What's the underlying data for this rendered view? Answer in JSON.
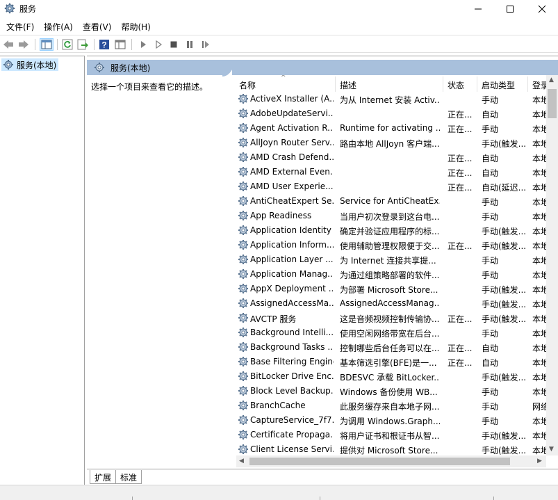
{
  "window": {
    "title": "服务"
  },
  "menu": [
    "文件(F)",
    "操作(A)",
    "查看(V)",
    "帮助(H)"
  ],
  "toolbar": {
    "icons": [
      "back-icon",
      "forward-icon",
      "show-hide-console-tree-icon",
      "refresh-icon",
      "export-list-icon",
      "help-icon",
      "properties-view-icon",
      "start-service-icon",
      "start-service-alt-icon",
      "stop-service-icon",
      "pause-service-icon",
      "restart-service-icon"
    ]
  },
  "tree": {
    "root_label": "服务(本地)"
  },
  "pane_header": {
    "title": "服务(本地)"
  },
  "description_prompt": "选择一个项目来查看它的描述。",
  "columns": {
    "name": "名称",
    "description": "描述",
    "status": "状态",
    "startup": "启动类型",
    "logon": "登录"
  },
  "services": [
    {
      "name": "ActiveX Installer (A...",
      "description": "为从 Internet 安装 Activ...",
      "status": "",
      "startup": "手动",
      "logon": "本地"
    },
    {
      "name": "AdobeUpdateServi...",
      "description": "",
      "status": "正在...",
      "startup": "自动",
      "logon": "本地"
    },
    {
      "name": "Agent Activation R...",
      "description": "Runtime for activating ...",
      "status": "正在...",
      "startup": "手动",
      "logon": "本地"
    },
    {
      "name": "AllJoyn Router Serv...",
      "description": "路由本地 AllJoyn 客户端...",
      "status": "",
      "startup": "手动(触发...",
      "logon": "本地"
    },
    {
      "name": "AMD Crash Defend...",
      "description": "",
      "status": "正在...",
      "startup": "自动",
      "logon": "本地"
    },
    {
      "name": "AMD External Even...",
      "description": "",
      "status": "正在...",
      "startup": "自动",
      "logon": "本地"
    },
    {
      "name": "AMD User Experie...",
      "description": "",
      "status": "正在...",
      "startup": "自动(延迟...",
      "logon": "本地"
    },
    {
      "name": "AntiCheatExpert Se...",
      "description": "Service for AntiCheatEx...",
      "status": "",
      "startup": "手动",
      "logon": "本地"
    },
    {
      "name": "App Readiness",
      "description": "当用户初次登录到这台电...",
      "status": "",
      "startup": "手动",
      "logon": "本地"
    },
    {
      "name": "Application Identity",
      "description": "确定并验证应用程序的标...",
      "status": "",
      "startup": "手动(触发...",
      "logon": "本地"
    },
    {
      "name": "Application Inform...",
      "description": "使用辅助管理权限便于交...",
      "status": "正在...",
      "startup": "手动(触发...",
      "logon": "本地"
    },
    {
      "name": "Application Layer ...",
      "description": "为 Internet 连接共享提...",
      "status": "",
      "startup": "手动",
      "logon": "本地"
    },
    {
      "name": "Application Manag...",
      "description": "为通过组策略部署的软件...",
      "status": "",
      "startup": "手动",
      "logon": "本地"
    },
    {
      "name": "AppX Deployment ...",
      "description": "为部署 Microsoft Store...",
      "status": "",
      "startup": "手动(触发...",
      "logon": "本地"
    },
    {
      "name": "AssignedAccessMa...",
      "description": "AssignedAccessManag...",
      "status": "",
      "startup": "手动(触发...",
      "logon": "本地"
    },
    {
      "name": "AVCTP 服务",
      "description": "这是音频视频控制传输协...",
      "status": "正在...",
      "startup": "手动(触发...",
      "logon": "本地"
    },
    {
      "name": "Background Intelli...",
      "description": "使用空闲网络带宽在后台...",
      "status": "",
      "startup": "手动",
      "logon": "本地"
    },
    {
      "name": "Background Tasks ...",
      "description": "控制哪些后台任务可以在...",
      "status": "正在...",
      "startup": "自动",
      "logon": "本地"
    },
    {
      "name": "Base Filtering Engine",
      "description": "基本筛选引擎(BFE)是一...",
      "status": "正在...",
      "startup": "自动",
      "logon": "本地"
    },
    {
      "name": "BitLocker Drive Enc...",
      "description": "BDESVC 承载 BitLocker...",
      "status": "",
      "startup": "手动(触发...",
      "logon": "本地"
    },
    {
      "name": "Block Level Backup...",
      "description": "Windows 备份使用 WB...",
      "status": "",
      "startup": "手动",
      "logon": "本地"
    },
    {
      "name": "BranchCache",
      "description": "此服务缓存来自本地子网...",
      "status": "",
      "startup": "手动",
      "logon": "网络"
    },
    {
      "name": "CaptureService_7f7...",
      "description": "为调用 Windows.Graph...",
      "status": "",
      "startup": "手动",
      "logon": "本地"
    },
    {
      "name": "Certificate Propaga...",
      "description": "将用户证书和根证书从智...",
      "status": "",
      "startup": "手动(触发...",
      "logon": "本地"
    },
    {
      "name": "Client License Servi...",
      "description": "提供对 Microsoft Store...",
      "status": "",
      "startup": "手动(触发...",
      "logon": "本地"
    }
  ],
  "tabs": [
    "扩展",
    "标准"
  ]
}
